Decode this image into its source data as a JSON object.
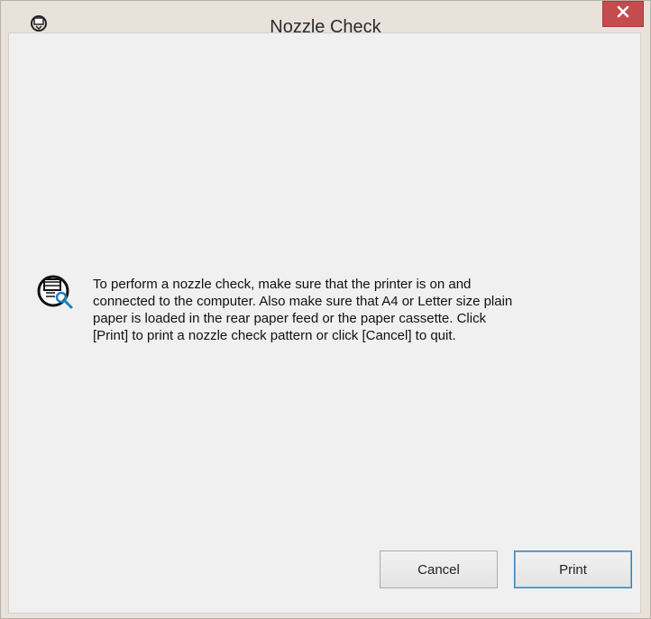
{
  "window": {
    "title": "Nozzle Check",
    "app_icon": "printer-head-icon",
    "close_icon": "close-icon",
    "colors": {
      "close_bg": "#c44b4e",
      "chrome": "#e9e2db",
      "client_bg": "#f0f0f0",
      "default_button_border": "#3c7fb1"
    }
  },
  "message": {
    "icon": "nozzle-check-icon",
    "text": "To perform a nozzle check, make sure that the printer is on and\nconnected to the computer. Also make sure that A4 or Letter size plain\npaper is loaded in the rear paper feed or the paper cassette. Click\n[Print] to print a nozzle check pattern or click [Cancel] to quit."
  },
  "buttons": {
    "cancel_label": "Cancel",
    "print_label": "Print"
  }
}
